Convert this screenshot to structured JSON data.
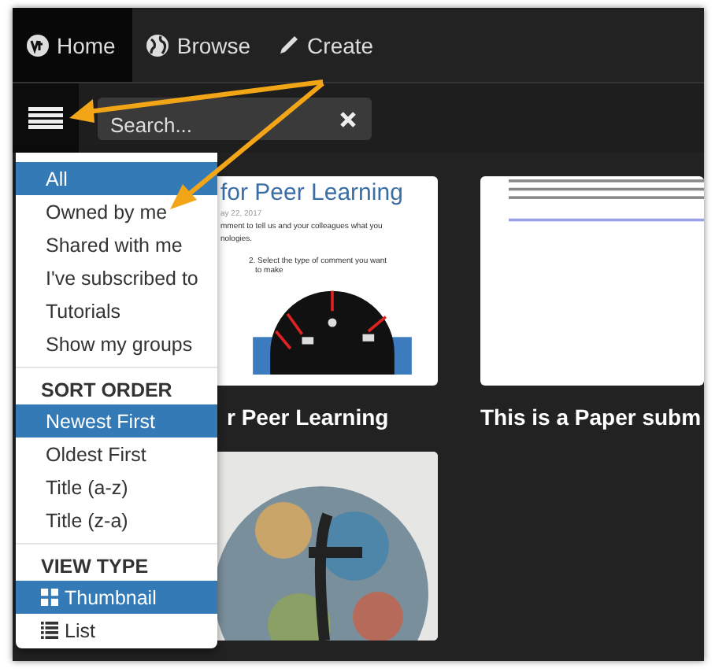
{
  "nav": {
    "tabs": [
      {
        "label": "Home",
        "selected": true
      },
      {
        "label": "Browse",
        "selected": false
      },
      {
        "label": "Create",
        "selected": false
      }
    ]
  },
  "toolbar": {
    "search": {
      "placeholder": "Search..."
    }
  },
  "menu": {
    "groups": [
      {
        "kind": "filter",
        "items": [
          {
            "label": "All",
            "selected": true
          },
          {
            "label": "Owned by me",
            "selected": false
          },
          {
            "label": "Shared with me",
            "selected": false
          },
          {
            "label": "I've subscribed to",
            "selected": false
          },
          {
            "label": "Tutorials",
            "selected": false
          },
          {
            "label": "Show my groups",
            "selected": false
          }
        ]
      },
      {
        "kind": "sort",
        "header": "SORT ORDER",
        "items": [
          {
            "label": "Newest First",
            "selected": true
          },
          {
            "label": "Oldest First",
            "selected": false
          },
          {
            "label": "Title (a-z)",
            "selected": false
          },
          {
            "label": "Title (z-a)",
            "selected": false
          }
        ]
      },
      {
        "kind": "view",
        "header": "VIEW TYPE",
        "items": [
          {
            "label": "Thumbnail",
            "selected": true
          },
          {
            "label": "List",
            "selected": false
          }
        ]
      }
    ]
  },
  "cards": [
    {
      "kind": "document",
      "title": "r Peer Learning",
      "thumbnail": {
        "heading": "for Peer Learning",
        "date": "ay 22, 2017",
        "lines": [
          "mment to tell us and your colleagues what you",
          "nologies."
        ],
        "step": "2. Select the type of comment you want",
        "step_cont": "to make"
      }
    },
    {
      "kind": "text-page",
      "title": "This is a Paper subm"
    },
    {
      "kind": "picture"
    }
  ],
  "annotations": [
    {
      "kind": "arrow"
    },
    {
      "kind": "arrow"
    }
  ]
}
